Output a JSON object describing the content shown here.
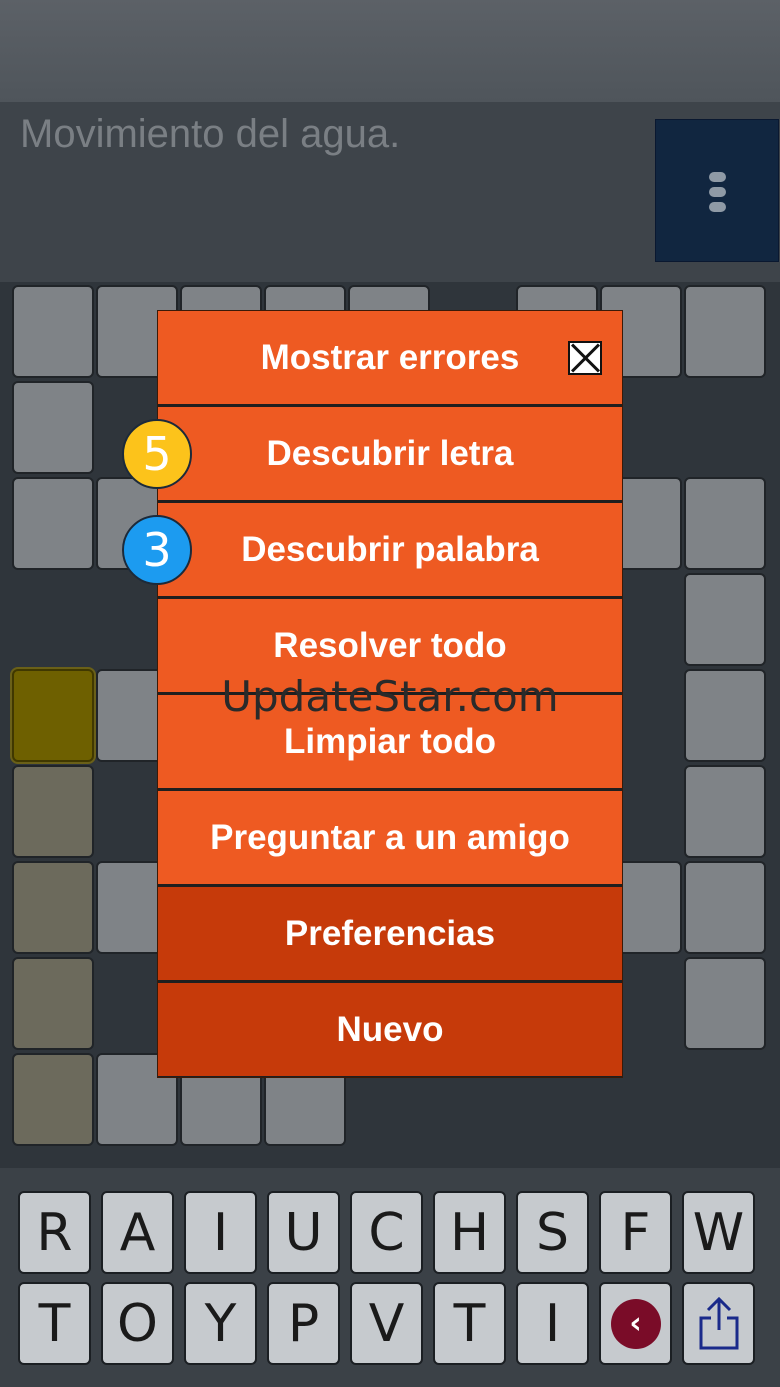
{
  "clue": {
    "text": "Movimiento del agua."
  },
  "menu": {
    "items": [
      {
        "label": "Mostrar errores"
      },
      {
        "label": "Descubrir letra"
      },
      {
        "label": "Descubrir palabra"
      },
      {
        "label": "Resolver todo"
      },
      {
        "label": "Limpiar todo"
      },
      {
        "label": "Preguntar a un amigo"
      },
      {
        "label": "Preferencias"
      },
      {
        "label": "Nuevo"
      }
    ],
    "badges": {
      "letter_hints": "5",
      "word_hints": "3"
    }
  },
  "watermark": "UpdateStar.com",
  "keyboard": {
    "row1": [
      "R",
      "A",
      "I",
      "U",
      "C",
      "H",
      "S",
      "F",
      "W"
    ],
    "row2": [
      "T",
      "O",
      "Y",
      "P",
      "V",
      "T",
      "I"
    ],
    "back_glyph": "‹"
  },
  "colors": {
    "menu_orange": "#ee5a22",
    "menu_dark_orange": "#c63a0a",
    "badge_yellow": "#fcc31b",
    "badge_blue": "#1c9bf0",
    "menu_button_navy": "#112640",
    "selected_cell": "#6e6000"
  }
}
